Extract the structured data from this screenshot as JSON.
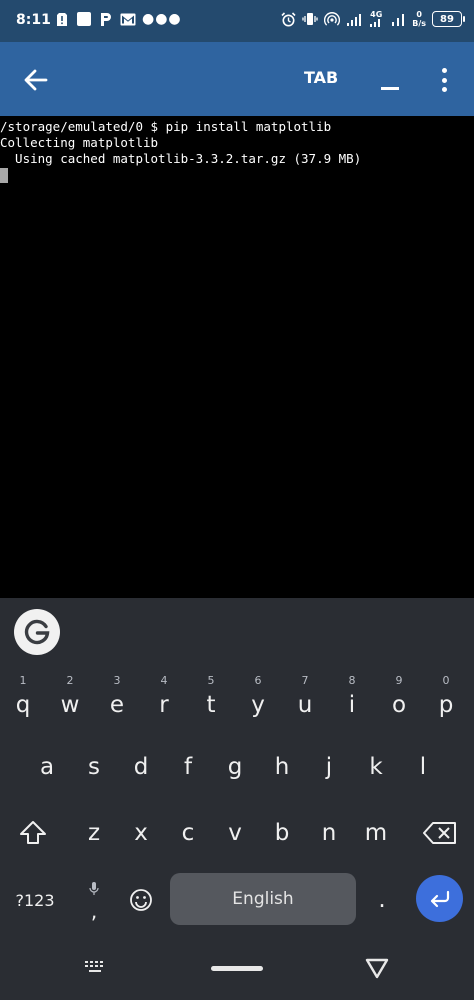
{
  "status_bar": {
    "time": "8:11",
    "icons_left": [
      "sim-alert-icon",
      "square-icon",
      "paytm-p-icon",
      "gmail-icon",
      "more-dots-icon"
    ],
    "icons_right": [
      "alarm-icon",
      "vibrate-icon",
      "hotspot-icon",
      "signal-icon",
      "signal-4g-icon",
      "signal-icon",
      "netspeed-icon",
      "battery-icon"
    ],
    "network_type": "4G",
    "net_speed_value": "0",
    "net_speed_unit": "B/s",
    "battery_level": "89",
    "text_color": "#ffffff",
    "bg_color": "#244a6e"
  },
  "app_bar": {
    "tab_label": "TAB",
    "bg_color": "#2f64a0"
  },
  "terminal": {
    "lines": [
      "/storage/emulated/0 $ pip install matplotlib",
      "Collecting matplotlib",
      "  Using cached matplotlib-3.3.2.tar.gz (37.9 MB)"
    ],
    "bg_color": "#000000",
    "text_color": "#ffffff"
  },
  "keyboard": {
    "bg_color": "#2a2d33",
    "row1": [
      {
        "hint": "1",
        "label": "q"
      },
      {
        "hint": "2",
        "label": "w"
      },
      {
        "hint": "3",
        "label": "e"
      },
      {
        "hint": "4",
        "label": "r"
      },
      {
        "hint": "5",
        "label": "t"
      },
      {
        "hint": "6",
        "label": "y"
      },
      {
        "hint": "7",
        "label": "u"
      },
      {
        "hint": "8",
        "label": "i"
      },
      {
        "hint": "9",
        "label": "o"
      },
      {
        "hint": "0",
        "label": "p"
      }
    ],
    "row2": [
      "a",
      "s",
      "d",
      "f",
      "g",
      "h",
      "j",
      "k",
      "l"
    ],
    "row3": [
      "z",
      "x",
      "c",
      "v",
      "b",
      "n",
      "m"
    ],
    "symbols_label": "?123",
    "comma_label": ",",
    "space_label": "English",
    "period_label": ".",
    "enter_color": "#3d6fdc"
  }
}
